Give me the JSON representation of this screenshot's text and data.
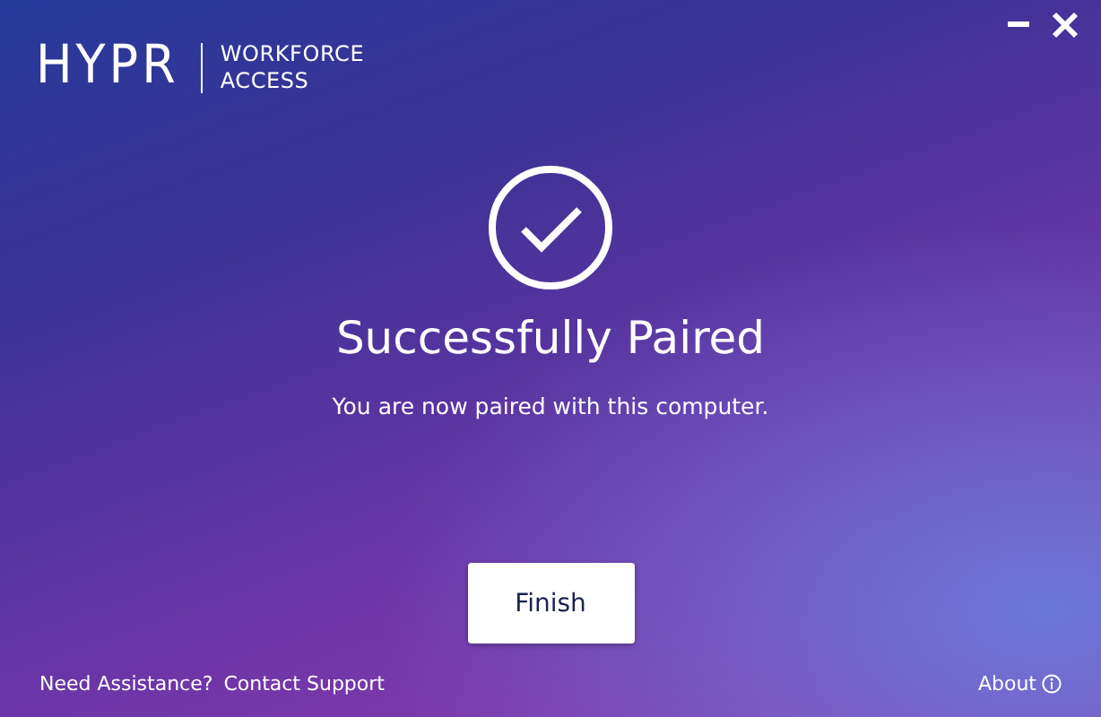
{
  "header": {
    "logo": "HYPR",
    "product": [
      "WORKFORCE",
      "ACCESS"
    ]
  },
  "window_controls": [
    {
      "kind": "minimize"
    },
    {
      "kind": "close"
    }
  ],
  "status": {
    "kind": "success",
    "title": "Successfully Paired",
    "message": "You are now paired with this computer."
  },
  "button": "Finish",
  "footer": {
    "help_text": "Need Assistance?",
    "link": "Contact Support",
    "about": "About"
  }
}
